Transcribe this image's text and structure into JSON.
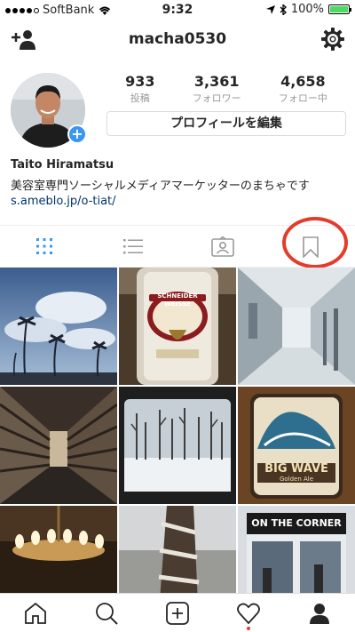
{
  "status_bar": {
    "carrier": "SoftBank",
    "time": "9:32",
    "battery": "100%"
  },
  "header": {
    "username": "macha0530"
  },
  "profile": {
    "stats": [
      {
        "value": "933",
        "label": "投稿"
      },
      {
        "value": "3,361",
        "label": "フォロワー"
      },
      {
        "value": "4,658",
        "label": "フォロー中"
      }
    ],
    "edit_button": "プロフィールを編集",
    "display_name": "Taito Hiramatsu",
    "bio": "美容室専門ソーシャルメディアマーケッターのまちゃです",
    "link": "s.ameblo.jp/o-tiat/"
  },
  "tabs": [
    {
      "icon": "grid-icon",
      "active": true
    },
    {
      "icon": "list-icon",
      "active": false
    },
    {
      "icon": "tagged-icon",
      "active": false
    },
    {
      "icon": "bookmark-icon",
      "active": false
    }
  ],
  "grid_photos": [
    {
      "subject": "palm-trees-clouds"
    },
    {
      "subject": "schneider-weisse-bottle"
    },
    {
      "subject": "hallway"
    },
    {
      "subject": "warehouse-shelves"
    },
    {
      "subject": "snowy-forest-car"
    },
    {
      "subject": "big-wave-beer-coaster"
    },
    {
      "subject": "chandelier"
    },
    {
      "subject": "tree-trunk"
    },
    {
      "subject": "storefront"
    }
  ],
  "overlay_text": {
    "beer_brand": "SCHNEIDER WEISSE",
    "coaster_title": "BIG WAVE",
    "coaster_subtitle": "Golden Ale",
    "store_sign": "ON THE CORNER"
  },
  "bottom_nav": [
    {
      "icon": "home-icon"
    },
    {
      "icon": "search-icon"
    },
    {
      "icon": "add-post-icon"
    },
    {
      "icon": "heart-icon"
    },
    {
      "icon": "profile-icon"
    }
  ],
  "colors": {
    "accent_blue": "#3897f0",
    "annotation_red": "#e43b2b",
    "link": "#003569"
  }
}
